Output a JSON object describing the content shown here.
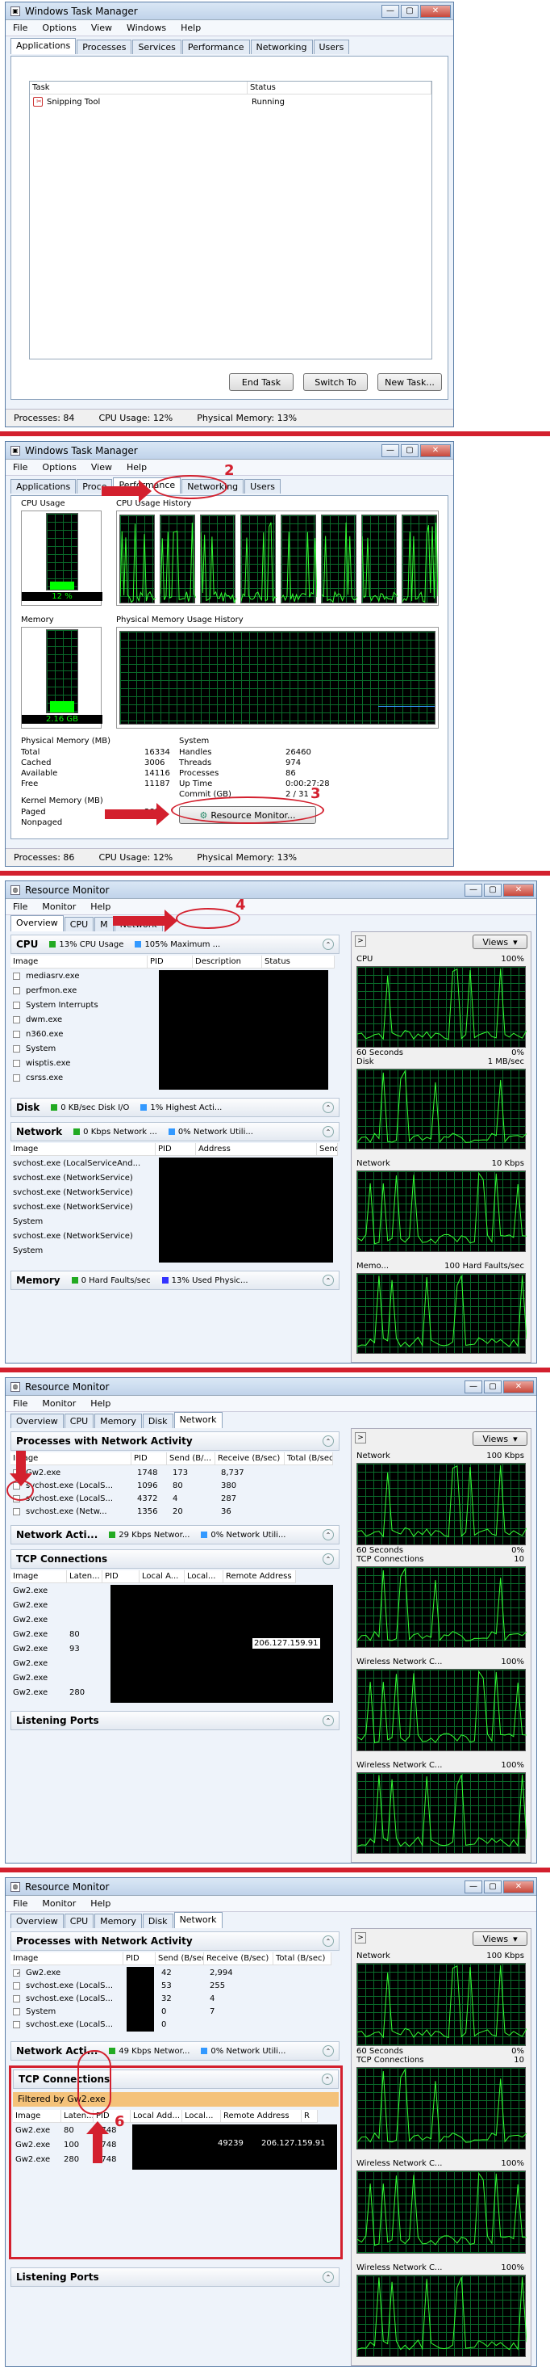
{
  "annotations": [
    "2",
    "3",
    "4",
    "6"
  ],
  "s1": {
    "title": "Windows Task Manager",
    "menu": [
      "File",
      "Options",
      "View",
      "Windows",
      "Help"
    ],
    "tabs": [
      "Applications",
      "Processes",
      "Services",
      "Performance",
      "Networking",
      "Users"
    ],
    "cols": [
      "Task",
      "Status"
    ],
    "task": "Snipping Tool",
    "status": "Running",
    "btns": [
      "End Task",
      "Switch To",
      "New Task..."
    ],
    "bar": [
      "Processes: 84",
      "CPU Usage: 12%",
      "Physical Memory: 13%"
    ]
  },
  "s2": {
    "title": "Windows Task Manager",
    "menu": [
      "File",
      "Options",
      "View",
      "Help"
    ],
    "tabs": [
      "Applications",
      "Processes",
      "Services",
      "Performance",
      "Networking",
      "Users"
    ],
    "tabs_visible": [
      "Applications",
      "Proce",
      "Performance",
      "Networking",
      "Users"
    ],
    "cpu_usage": "CPU Usage",
    "cpu_val": "12 %",
    "cpu_hist": "CPU Usage History",
    "mem": "Memory",
    "mem_val": "2.16 GB",
    "mem_hist": "Physical Memory Usage History",
    "pm_title": "Physical Memory (MB)",
    "pm": [
      [
        "Total",
        "16334"
      ],
      [
        "Cached",
        "3006"
      ],
      [
        "Available",
        "14116"
      ],
      [
        "Free",
        "11187"
      ]
    ],
    "sys_title": "System",
    "sys": [
      [
        "Handles",
        "26460"
      ],
      [
        "Threads",
        "974"
      ],
      [
        "Processes",
        "86"
      ],
      [
        "Up Time",
        "0:00:27:28"
      ],
      [
        "Commit (GB)",
        "2 / 31"
      ]
    ],
    "km_title": "Kernel Memory (MB)",
    "km": [
      [
        "Paged",
        "283"
      ],
      [
        "Nonpaged",
        ""
      ]
    ],
    "resmon": "Resource Monitor...",
    "bar": [
      "Processes: 86",
      "CPU Usage: 12%",
      "Physical Memory: 13%"
    ]
  },
  "s3": {
    "title": "Resource Monitor",
    "menu": [
      "File",
      "Monitor",
      "Help"
    ],
    "tabs": [
      "Overview",
      "CPU",
      "M",
      "Network"
    ],
    "cpu": {
      "label": "CPU",
      "c1": "13% CPU Usage",
      "c2": "105% Maximum ...",
      "cols": [
        "Image",
        "PID",
        "Description",
        "Status"
      ],
      "rows": [
        "mediasrv.exe",
        "perfmon.exe",
        "System Interrupts",
        "dwm.exe",
        "n360.exe",
        "System",
        "wisptis.exe",
        "csrss.exe"
      ]
    },
    "disk": {
      "label": "Disk",
      "c1": "0 KB/sec Disk I/O",
      "c2": "1% Highest Acti..."
    },
    "net": {
      "label": "Network",
      "c1": "0 Kbps Network ...",
      "c2": "0% Network Utili...",
      "cols": [
        "Image",
        "PID",
        "Address",
        "Send"
      ],
      "rows": [
        "svchost.exe (LocalServiceAnd...",
        "svchost.exe (NetworkService)",
        "svchost.exe (NetworkService)",
        "svchost.exe (NetworkService)",
        "System",
        "svchost.exe (NetworkService)",
        "System"
      ]
    },
    "mem": {
      "label": "Memory",
      "c1": "0 Hard Faults/sec",
      "c2": "13% Used Physic..."
    },
    "views": "Views",
    "g": [
      {
        "n": "CPU",
        "v": "100%",
        "b": "60 Seconds",
        "z": "0%"
      },
      {
        "n": "Disk",
        "v": "1 MB/sec"
      },
      {
        "n": "Network",
        "v": "10 Kbps"
      },
      {
        "n": "Memo...",
        "v": "100 Hard Faults/sec"
      }
    ]
  },
  "s4": {
    "title": "Resource Monitor",
    "menu": [
      "File",
      "Monitor",
      "Help"
    ],
    "tabs": [
      "Overview",
      "CPU",
      "Memory",
      "Disk",
      "Network"
    ],
    "pna": {
      "label": "Processes with Network Activity",
      "cols": [
        "Image",
        "PID",
        "Send (B/...",
        "Receive (B/sec)",
        "Total (B/sec)"
      ],
      "rows": [
        [
          "Gw2.exe",
          "1748",
          "173",
          "8,737",
          ""
        ],
        [
          "svchost.exe (LocalS...",
          "1096",
          "80",
          "380",
          ""
        ],
        [
          "svchost.exe (LocalS...",
          "4372",
          "4",
          "287",
          ""
        ],
        [
          "svchost.exe (Netw...",
          "1356",
          "20",
          "36",
          ""
        ]
      ]
    },
    "na": {
      "label": "Network Acti...",
      "c1": "29 Kbps Networ...",
      "c2": "0% Network Utili..."
    },
    "tcp": {
      "label": "TCP Connections",
      "cols": [
        "Image",
        "Laten...",
        "PID",
        "Local A...",
        "Local...",
        "Remote Address"
      ],
      "rows": [
        [
          "Gw2.exe",
          ""
        ],
        [
          "Gw2.exe",
          ""
        ],
        [
          "Gw2.exe",
          ""
        ],
        [
          "Gw2.exe",
          "80"
        ],
        [
          "Gw2.exe",
          "93"
        ],
        [
          "Gw2.exe",
          ""
        ],
        [
          "Gw2.exe",
          ""
        ],
        [
          "Gw2.exe",
          "280"
        ]
      ],
      "ip": "206.127.159.91"
    },
    "lp": "Listening Ports",
    "views": "Views",
    "g": [
      {
        "n": "Network",
        "v": "100 Kbps",
        "b": "60 Seconds",
        "z": "0%"
      },
      {
        "n": "TCP Connections",
        "v": "10"
      },
      {
        "n": "Wireless Network C...",
        "v": "100%"
      },
      {
        "n": "Wireless Network C...",
        "v": "100%"
      }
    ]
  },
  "s5": {
    "title": "Resource Monitor",
    "menu": [
      "File",
      "Monitor",
      "Help"
    ],
    "tabs": [
      "Overview",
      "CPU",
      "Memory",
      "Disk",
      "Network"
    ],
    "pna": {
      "label": "Processes with Network Activity",
      "cols": [
        "Image",
        "PID",
        "Send (B/sec)",
        "Receive (B/sec)",
        "Total (B/sec)"
      ],
      "rows": [
        [
          "Gw2.exe",
          "",
          "42",
          "2,994",
          ""
        ],
        [
          "svchost.exe (LocalS...",
          "",
          "53",
          "255",
          ""
        ],
        [
          "svchost.exe (LocalS...",
          "",
          "32",
          "4",
          ""
        ],
        [
          "System",
          "",
          "0",
          "7",
          ""
        ],
        [
          "svchost.exe (LocalS...",
          "",
          "0",
          "",
          ""
        ]
      ]
    },
    "na": {
      "label": "Network Acti...",
      "c1": "49 Kbps Networ...",
      "c2": "0% Network Utili..."
    },
    "tcp": {
      "label": "TCP Connections",
      "filter": "Filtered by Gw2.exe",
      "cols": [
        "Image",
        "Laten...",
        "PID",
        "Local Add...",
        "Local...",
        "Remote Address",
        "R"
      ],
      "rows": [
        [
          "Gw2.exe",
          "80",
          "1748"
        ],
        [
          "Gw2.exe",
          "100",
          "1748"
        ],
        [
          "Gw2.exe",
          "280",
          "1748"
        ]
      ],
      "lport": "49239",
      "ip": "206.127.159.91"
    },
    "lp": "Listening Ports",
    "views": "Views",
    "g": [
      {
        "n": "Network",
        "v": "100 Kbps",
        "b": "60 Seconds",
        "z": "0%"
      },
      {
        "n": "TCP Connections",
        "v": "10"
      },
      {
        "n": "Wireless Network C...",
        "v": "100%"
      },
      {
        "n": "Wireless Network C...",
        "v": "100%"
      }
    ]
  }
}
